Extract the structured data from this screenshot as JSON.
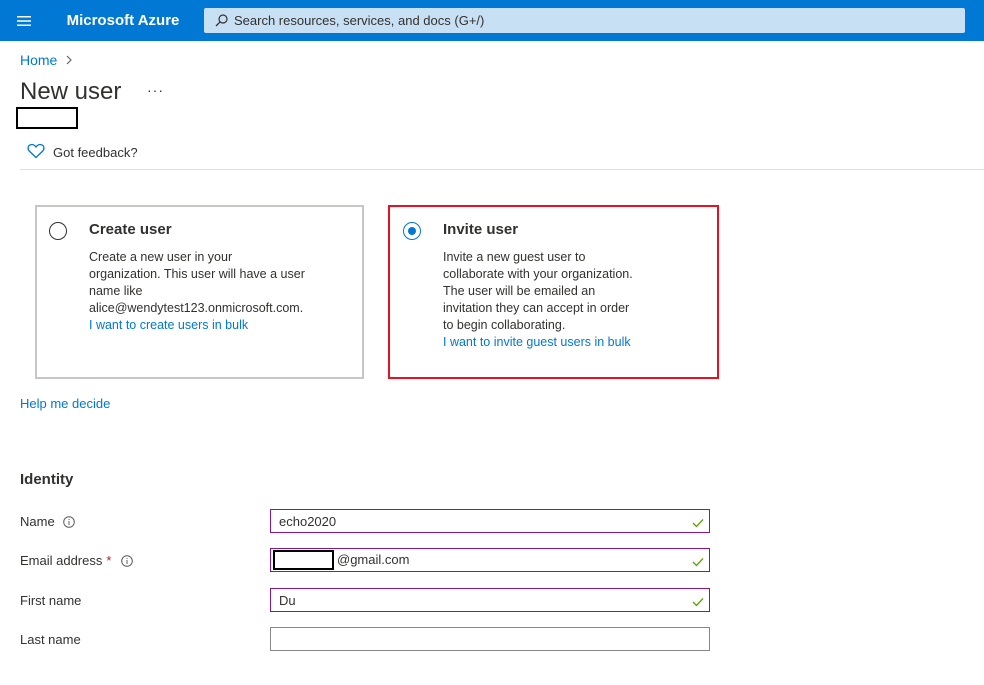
{
  "header": {
    "brand": "Microsoft Azure",
    "search_placeholder": "Search resources, services, and docs (G+/)",
    "accent_color": "#0078d4"
  },
  "breadcrumb": {
    "home": "Home"
  },
  "page": {
    "title": "New user",
    "more_label": "···",
    "feedback": "Got feedback?"
  },
  "options": {
    "create": {
      "title": "Create user",
      "description_lines": [
        "Create a new user in your",
        "organization. This user will have a user",
        "name like",
        "alice@wendytest123.onmicrosoft.com."
      ],
      "link": "I want to create users in bulk",
      "selected": false
    },
    "invite": {
      "title": "Invite user",
      "description_lines": [
        "Invite a new guest user to",
        "collaborate with your organization.",
        "The user will be emailed an",
        "invitation they can accept in order",
        "to begin collaborating."
      ],
      "link": "I want to invite guest users in bulk",
      "selected": true
    }
  },
  "help_link": "Help me decide",
  "identity": {
    "title": "Identity",
    "fields": {
      "name": {
        "label": "Name",
        "value": "echo2020"
      },
      "email": {
        "label": "Email address",
        "required_mark": "*",
        "domain_suffix": "@gmail.com"
      },
      "first_name": {
        "label": "First name",
        "value": "Du"
      },
      "last_name": {
        "label": "Last name",
        "value": ""
      }
    }
  }
}
